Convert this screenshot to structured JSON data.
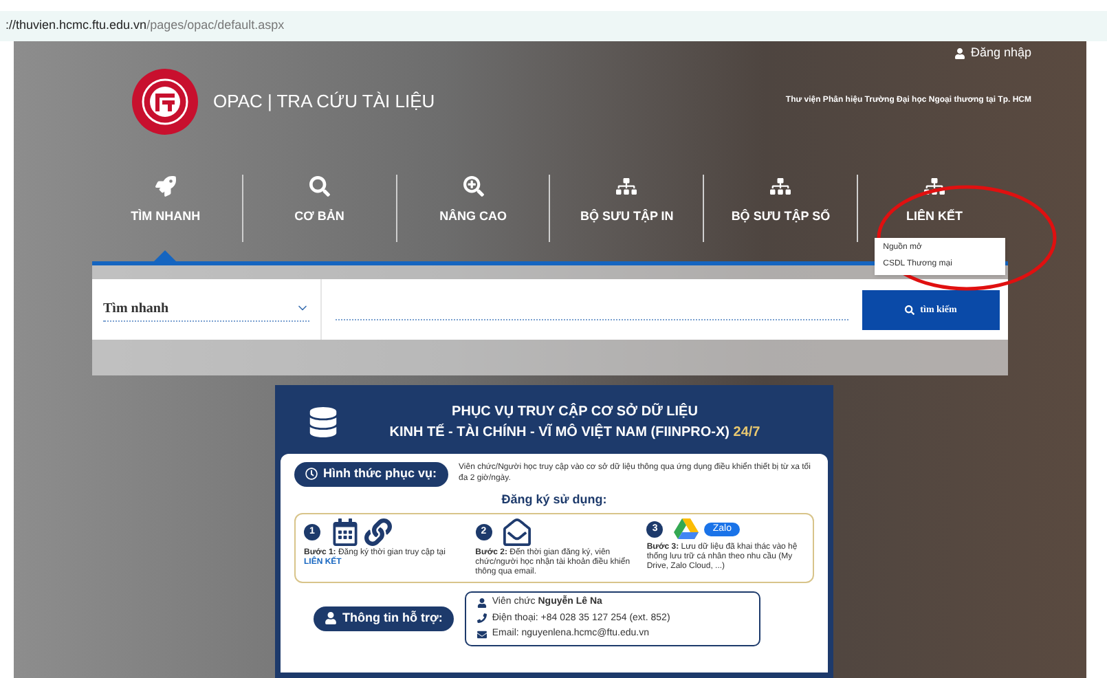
{
  "address_bar": {
    "host": "://thuvien.hcmc.ftu.edu.vn",
    "path": "/pages/opac/default.aspx"
  },
  "header": {
    "login": "Đăng nhập",
    "site_title": "OPAC | TRA CỨU TÀI LIỆU",
    "institution": "Thư viện Phân hiệu Trường Đại học Ngoại thương tại Tp. HCM"
  },
  "nav": [
    {
      "label": "TÌM NHANH",
      "kind": "rocket",
      "selected": true
    },
    {
      "label": "CƠ BẢN",
      "kind": "search",
      "selected": false
    },
    {
      "label": "NÂNG CAO",
      "kind": "zoom",
      "selected": false
    },
    {
      "label": "BỘ SƯU TẬP IN",
      "kind": "tree",
      "selected": false
    },
    {
      "label": "BỘ SƯU TẬP SỐ",
      "kind": "tree",
      "selected": false
    },
    {
      "label": "LIÊN KẾT",
      "kind": "tree",
      "selected": false,
      "expanded": true,
      "menu": [
        "Nguồn mở",
        "CSDL Thương mại"
      ]
    }
  ],
  "search": {
    "mode": "Tìm nhanh",
    "button": "tìm kiếm"
  },
  "poster": {
    "title_1": "PHỤC VỤ TRUY CẬP CƠ SỞ DỮ LIỆU",
    "title_2": "KINH TẾ - TÀI CHÍNH - VĨ MÔ VIỆT NAM (FIINPRO-X)",
    "title_badge": "24/7",
    "service_label": "Hình thức phục vụ:",
    "service_text": "Viên chức/Người học truy cập vào cơ sở dữ liệu thông qua ứng dụng điều khiển thiết bị từ xa tối đa 2 giờ/ngày.",
    "register_heading": "Đăng ký sử dụng:",
    "steps": [
      {
        "number": "1",
        "kind": "calendar",
        "text": "**Bước 1:** Đăng ký thời gian truy cập tại",
        "link": "LIÊN KẾT"
      },
      {
        "number": "2",
        "kind": "mail",
        "text": "**Bước 2:** Đến thời gian đăng ký, viên chức/người học nhận tài khoản điều khiển thông qua email."
      },
      {
        "number": "3",
        "kind": "cloud",
        "text": "**Bước 3:** Lưu dữ liệu đã khai thác vào hệ thống lưu trữ cá nhân theo nhu cầu (My Drive, Zalo Cloud, ...)",
        "badge": "Zalo"
      }
    ],
    "support_label": "Thông tin hỗ trợ:",
    "contacts": [
      {
        "kind": "person",
        "text": "Viên chức **Nguyễn Lê Na**"
      },
      {
        "kind": "phone",
        "text": "Điện thoại: +84 028 35 127 254 (ext. 852)"
      },
      {
        "kind": "email",
        "text": "Email: nguyenlena.hcmc@ftu.edu.vn"
      }
    ]
  }
}
